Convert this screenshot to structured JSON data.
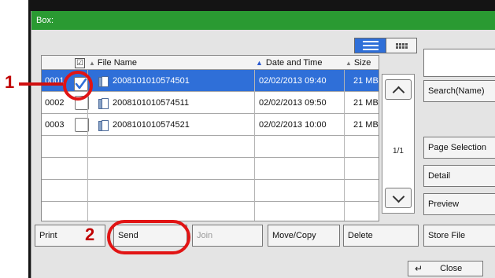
{
  "window": {
    "title": "Box:"
  },
  "table": {
    "headers": {
      "select_all": "☑",
      "file_name": "File Name",
      "date_time": "Date and Time",
      "size": "Size"
    },
    "rows": [
      {
        "number": "0001",
        "name": "2008101010574501",
        "date": "02/02/2013 09:40",
        "size": "21 MB",
        "selected": true
      },
      {
        "number": "0002",
        "name": "2008101010574511",
        "date": "02/02/2013 09:50",
        "size": "21 MB",
        "selected": false
      },
      {
        "number": "0003",
        "name": "2008101010574521",
        "date": "02/02/2013 10:00",
        "size": "21 MB",
        "selected": false
      }
    ]
  },
  "scroll": {
    "page_indicator": "1/1"
  },
  "right_panel": {
    "search_name": "Search(Name)",
    "page_selection": "Page Selection",
    "detail": "Detail",
    "preview": "Preview",
    "store_file": "Store File"
  },
  "bottom": {
    "print": "Print",
    "send": "Send",
    "join": "Join",
    "move_copy": "Move/Copy",
    "delete": "Delete",
    "close": "Close"
  },
  "callouts": {
    "one": "1",
    "two": "2"
  },
  "colors": {
    "title_bar": "#2a9a32",
    "selection": "#2f6fd8",
    "callout_red": "#e11414"
  }
}
